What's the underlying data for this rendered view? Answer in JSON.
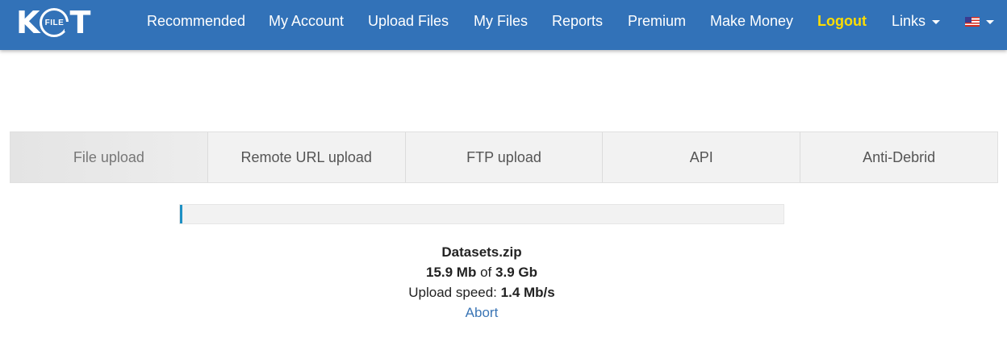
{
  "nav": {
    "logo": {
      "left": "K",
      "ring": "FILE",
      "right": "T"
    },
    "items": [
      {
        "label": "Recommended"
      },
      {
        "label": "My Account"
      },
      {
        "label": "Upload Files"
      },
      {
        "label": "My Files"
      },
      {
        "label": "Reports"
      },
      {
        "label": "Premium"
      },
      {
        "label": "Make Money"
      },
      {
        "label": "Logout"
      },
      {
        "label": "Links"
      }
    ],
    "language_icon": "us-flag-icon"
  },
  "tabs": [
    {
      "label": "File upload",
      "active": true
    },
    {
      "label": "Remote URL upload"
    },
    {
      "label": "FTP upload"
    },
    {
      "label": "API"
    },
    {
      "label": "Anti-Debrid"
    }
  ],
  "upload": {
    "file_name": "Datasets.zip",
    "uploaded": "15.9 Mb",
    "of_text": "of",
    "total": "3.9 Gb",
    "speed_label": "Upload speed:",
    "speed": "1.4 Mb/s",
    "abort_label": "Abort",
    "progress": 0.004
  },
  "colors": {
    "navbar": "#3272b8",
    "logout": "#ffdd00",
    "progress_fill": "#1e90c4",
    "link": "#3a75b5"
  }
}
